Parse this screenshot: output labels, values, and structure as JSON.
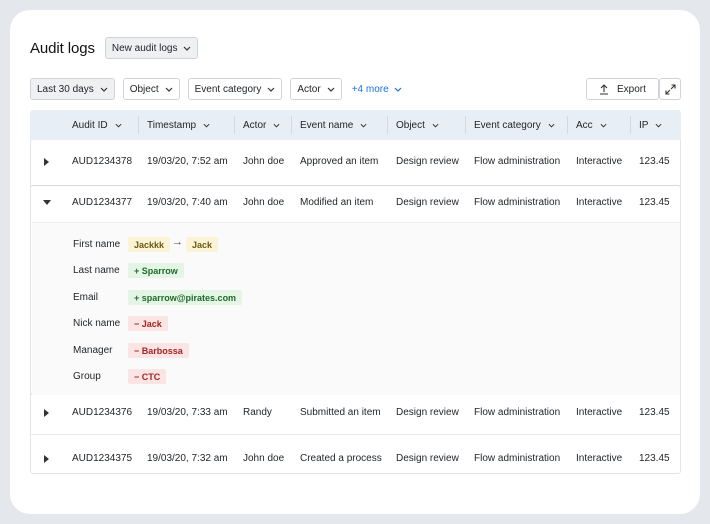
{
  "header": {
    "title": "Audit logs",
    "view_selector": "New audit logs"
  },
  "filters": {
    "date_range": "Last 30 days",
    "object": "Object",
    "event_category": "Event category",
    "actor": "Actor",
    "more": "+4 more"
  },
  "actions": {
    "export": "Export"
  },
  "table": {
    "columns": [
      "Audit ID",
      "Timestamp",
      "Actor",
      "Event name",
      "Object",
      "Event category",
      "Acc",
      "IP"
    ],
    "rows": [
      {
        "audit_id": "AUD1234378",
        "timestamp": "19/03/20, 7:52 am",
        "actor": "John doe",
        "event_name": "Approved an item",
        "object": "Design review",
        "event_category": "Flow administration",
        "acc": "Interactive",
        "ip": "123.45"
      },
      {
        "audit_id": "AUD1234377",
        "timestamp": "19/03/20, 7:40 am",
        "actor": "John doe",
        "event_name": "Modified an item",
        "object": "Design review",
        "event_category": "Flow administration",
        "acc": "Interactive",
        "ip": "123.45"
      },
      {
        "audit_id": "AUD1234376",
        "timestamp": "19/03/20, 7:33 am",
        "actor": "Randy",
        "event_name": "Submitted an item",
        "object": "Design review",
        "event_category": "Flow administration",
        "acc": "Interactive",
        "ip": "123.45"
      },
      {
        "audit_id": "AUD1234375",
        "timestamp": "19/03/20, 7:32 am",
        "actor": "John doe",
        "event_name": "Created a process",
        "object": "Design review",
        "event_category": "Flow administration",
        "acc": "Interactive",
        "ip": "123.45"
      }
    ]
  },
  "details": {
    "first_name": {
      "label": "First name",
      "old": "Jackkk",
      "new": "Jack"
    },
    "last_name": {
      "label": "Last name",
      "change": "+ Sparrow"
    },
    "email": {
      "label": "Email",
      "change": "+ sparrow@pirates.com"
    },
    "nick_name": {
      "label": "Nick name",
      "change": "− Jack"
    },
    "manager": {
      "label": "Manager",
      "change": "− Barbossa"
    },
    "group": {
      "label": "Group",
      "change": "− CTC"
    }
  },
  "colors": {
    "header_bg": "#e8eef5",
    "link": "#1a73e8",
    "added": "#1f6b2c",
    "removed": "#a42424",
    "modified": "#6b5a12"
  }
}
